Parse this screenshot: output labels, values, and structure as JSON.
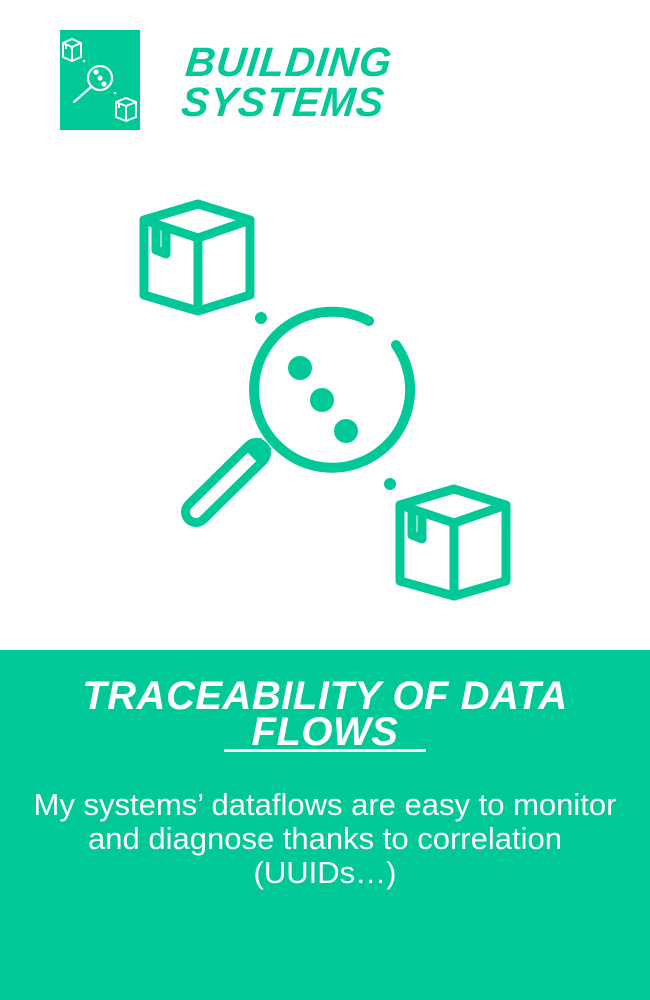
{
  "header": {
    "logo_icon": "magnifier-boxes-icon",
    "title_line1": "BUILDING",
    "title_line2": "SYSTEMS"
  },
  "hero": {
    "icon": "data-trace-magnifier-icon"
  },
  "panel": {
    "title_line1": "TRACEABILITY OF DATA",
    "title_line2": "FLOWS",
    "description": "My systems’ dataflows are easy to monitor and diagnose thanks to correlation (UUIDs…)"
  },
  "colors": {
    "accent": "#00c896",
    "text_on_accent": "#ffffff"
  }
}
